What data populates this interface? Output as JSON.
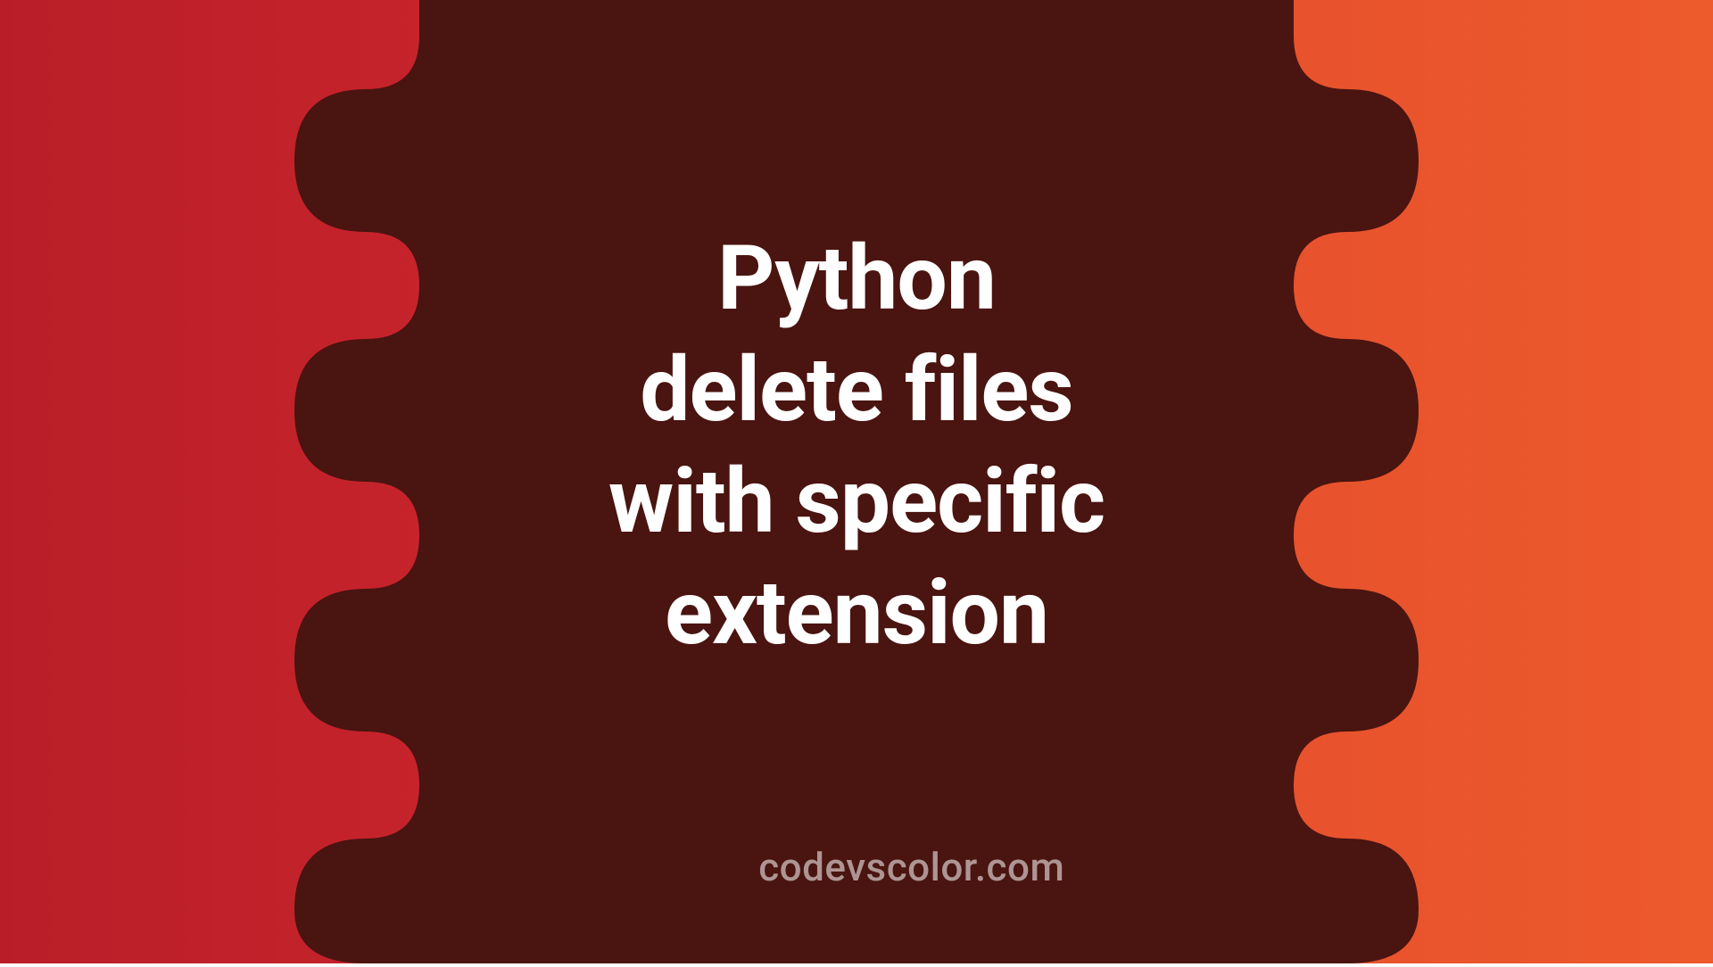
{
  "title": {
    "line1": "Python",
    "line2": "delete files",
    "line3": "with specific",
    "line4": "extension"
  },
  "watermark": "codevscolor.com",
  "colors": {
    "bg_dark": "#4a1410",
    "left_start": "#b91e28",
    "left_end": "#d3292f",
    "right_start": "#ed5a2c",
    "right_end": "#e24a2e",
    "text": "#ffffff"
  }
}
